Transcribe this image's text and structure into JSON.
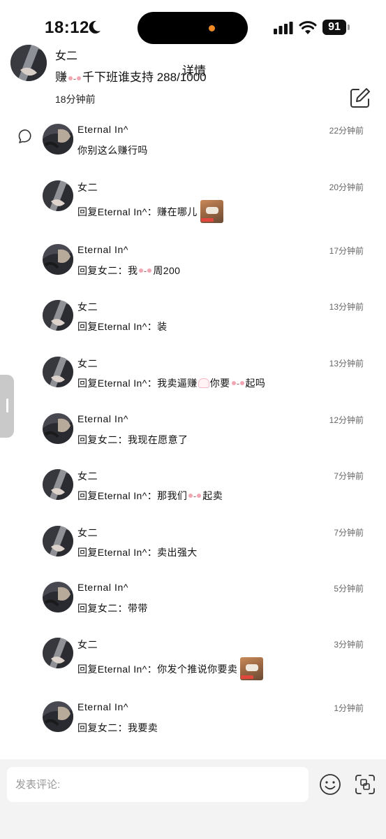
{
  "status": {
    "time": "18:12",
    "battery": "91"
  },
  "post": {
    "author": "女二",
    "text_before": "赚",
    "text_after": "千下班谁支持 288/1000",
    "detail_label": "详情",
    "time": "18分钟前"
  },
  "input": {
    "placeholder": "发表评论:"
  },
  "comments": [
    {
      "name": "Eternal In^",
      "time": "22分钟前",
      "text": "你别这么赚行吗",
      "avatar": "b"
    },
    {
      "name": "女二",
      "time": "20分钟前",
      "text": "回复Eternal In^：赚在哪儿",
      "avatar": "a",
      "thumb": true
    },
    {
      "name": "Eternal In^",
      "time": "17分钟前",
      "text_before": "回复女二：我",
      "text_after": "周200",
      "avatar": "b"
    },
    {
      "name": "女二",
      "time": "13分钟前",
      "text": "回复Eternal In^：装",
      "avatar": "a"
    },
    {
      "name": "女二",
      "time": "13分钟前",
      "text_before": "回复Eternal In^：我卖逼赚",
      "text_mid": "你要",
      "text_after": "起吗",
      "avatar": "a"
    },
    {
      "name": "Eternal In^",
      "time": "12分钟前",
      "text": "回复女二：我现在愿意了",
      "avatar": "b"
    },
    {
      "name": "女二",
      "time": "7分钟前",
      "text_before": "回复Eternal In^：那我们",
      "text_after": "起卖",
      "avatar": "a"
    },
    {
      "name": "女二",
      "time": "7分钟前",
      "text": "回复Eternal In^：卖出强大",
      "avatar": "a"
    },
    {
      "name": "Eternal In^",
      "time": "5分钟前",
      "text": "回复女二：带带",
      "avatar": "b"
    },
    {
      "name": "女二",
      "time": "3分钟前",
      "text": "回复Eternal In^：你发个推说你要卖",
      "avatar": "a",
      "thumb": true
    },
    {
      "name": "Eternal In^",
      "time": "1分钟前",
      "text": "回复女二：我要卖",
      "avatar": "b"
    }
  ]
}
